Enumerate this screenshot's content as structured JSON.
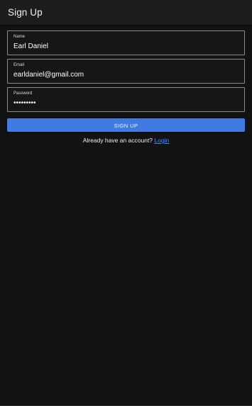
{
  "appbar": {
    "title": "Sign Up"
  },
  "form": {
    "name": {
      "label": "Name",
      "value": "Earl Daniel"
    },
    "email": {
      "label": "Email",
      "value": "earldaniel@gmail.com"
    },
    "password": {
      "label": "Password",
      "value": "•••••••••"
    },
    "submit_label": "SIGN UP"
  },
  "footer": {
    "prompt": "Already have an account?",
    "login_label": "Login"
  },
  "colors": {
    "background": "#121212",
    "appbar": "#1d1d1d",
    "primary": "#3f7be0",
    "link": "#3f8cff",
    "field_border": "#8a8a8a"
  }
}
